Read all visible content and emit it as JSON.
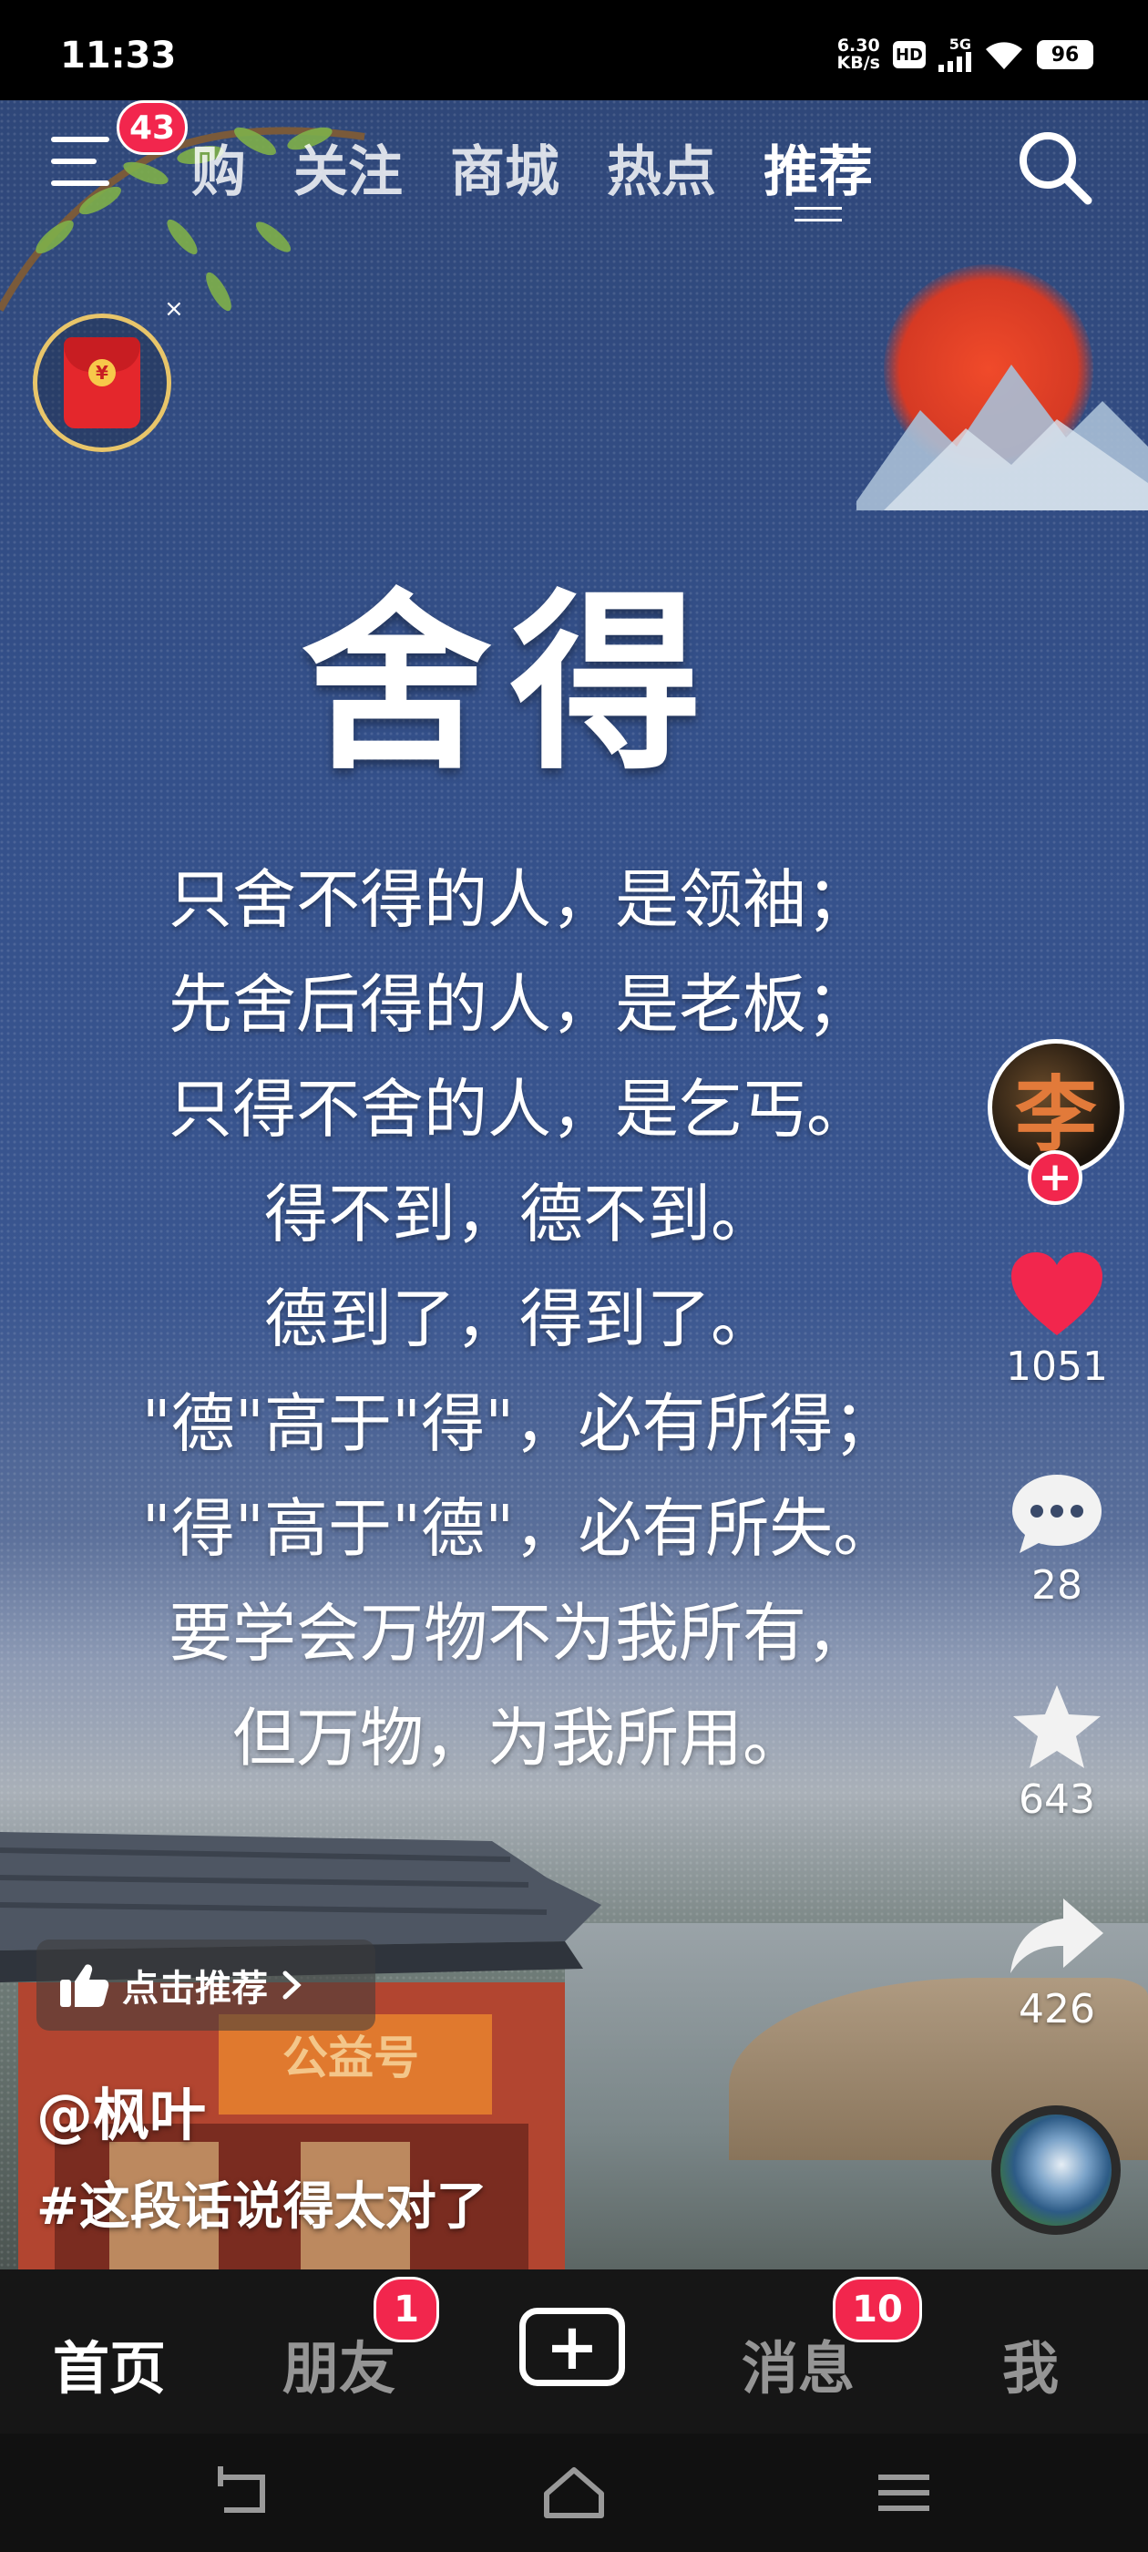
{
  "status_bar": {
    "time": "11:33",
    "net_speed_value": "6.30",
    "net_speed_unit": "KB/s",
    "hd": "HD",
    "network": "5G",
    "battery": "96"
  },
  "top_bar": {
    "menu_badge": "43",
    "tabs": [
      "购",
      "关注",
      "商城",
      "热点",
      "推荐"
    ],
    "active_tab": "推荐"
  },
  "red_packet": {
    "coin": "¥",
    "close": "×"
  },
  "poster": {
    "title": "舍得",
    "lines": [
      "只舍不得的人，是领袖；",
      "先舍后得的人，是老板；",
      "只得不舍的人，是乞丐。",
      "得不到，德不到。",
      "德到了，得到了。",
      "\"德\"高于\"得\"，必有所得；",
      "\"得\"高于\"德\"，必有所失。",
      "要学会万物不为我所有，",
      "但万物，为我所用。"
    ]
  },
  "scene": {
    "sign": "公益号"
  },
  "right_rail": {
    "avatar_char": "李",
    "follow": "+",
    "likes": "1051",
    "comments": "28",
    "favorites": "643",
    "shares": "426"
  },
  "video_info": {
    "recommend_chip": "点击推荐",
    "author": "@枫叶",
    "caption": "#这段话说得太对了"
  },
  "bottom_nav": {
    "home": "首页",
    "friends": "朋友",
    "friends_badge": "1",
    "add": "+",
    "messages": "消息",
    "messages_badge": "10",
    "me": "我"
  },
  "colors": {
    "badge": "#f2264d",
    "like_heart": "#f2264d",
    "background_poster": "#34508a"
  }
}
